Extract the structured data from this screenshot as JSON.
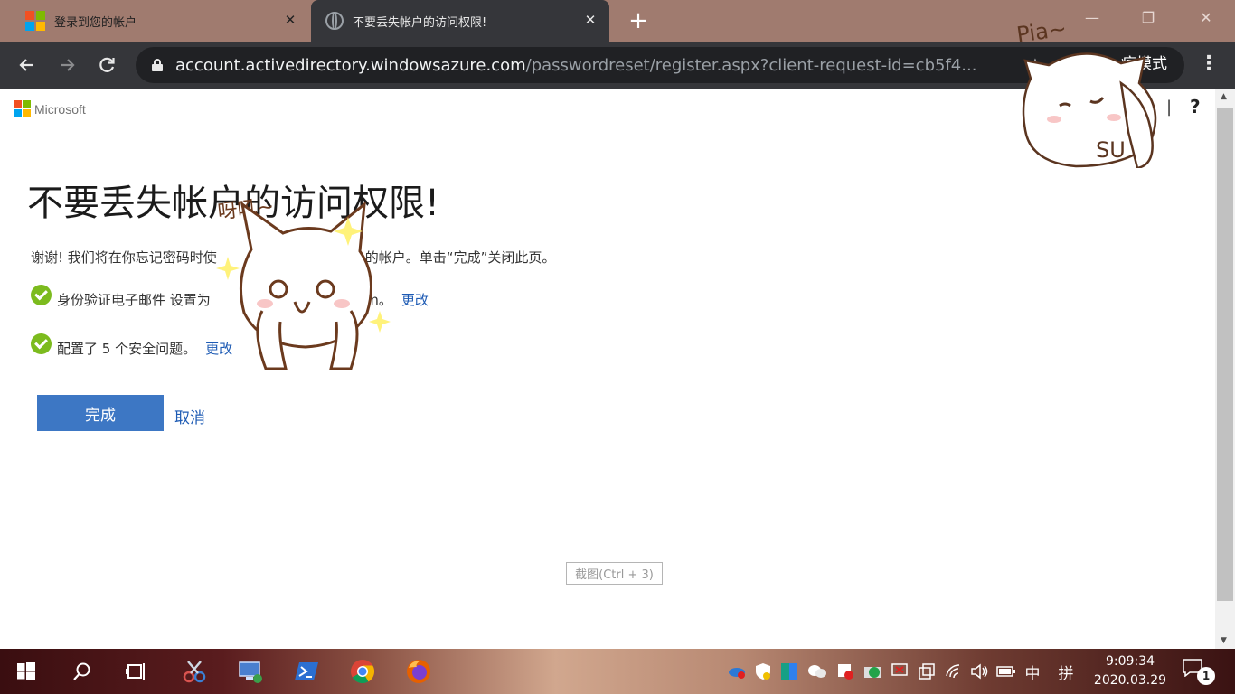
{
  "browser": {
    "tabs": [
      {
        "title": "登录到您的帐户",
        "icon": "microsoft-logo-icon",
        "active": false
      },
      {
        "title": "不要丢失帐户的访问权限!",
        "icon": "globe-icon",
        "active": true
      }
    ],
    "address": {
      "host": "account.activedirectory.windowsazure.com",
      "path": "/passwordreset/register.aspx?client-request-id=cb5f4..."
    },
    "incognito_label": "痕模式"
  },
  "header": {
    "brand": "Microsoft",
    "separator": "|",
    "help": "?"
  },
  "main": {
    "heading": "不要丢失帐户的访问权限!",
    "intro_before": "谢谢! 我们将在你忘记密码时使",
    "intro_after": "的帐户。单击“完成”关闭此页。",
    "items": [
      {
        "text_before": "身份验证电子邮件 设置为",
        "text_after": "com。",
        "link": "更改"
      },
      {
        "text": "配置了 5 个安全问题。",
        "link": "更改"
      }
    ],
    "finish_button": "完成",
    "cancel_link": "取消"
  },
  "screenshot_tip": "截图(Ctrl + 3)",
  "stickers": {
    "top_text": "Pia~",
    "cheek_text": "SU",
    "cat_text": "呀吼~"
  },
  "taskbar": {
    "time": "9:09:34",
    "date": "2020.03.29",
    "ime_lang": "中",
    "ime_mode": "拼",
    "notifications": "1"
  },
  "colors": {
    "tabstrip": "#a07b6f",
    "toolbar": "#35363a",
    "primary_button": "#3d77c4",
    "link": "#1e5bb4",
    "check": "#7cbb1e"
  }
}
